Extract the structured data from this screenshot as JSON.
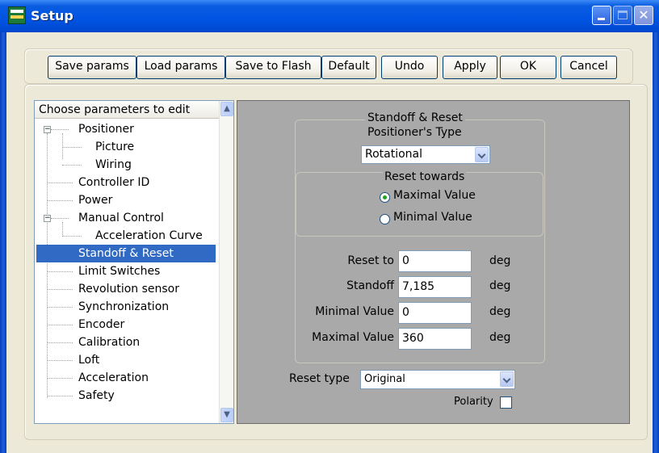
{
  "window": {
    "title": "Setup"
  },
  "toolbar": {
    "buttons": [
      "Save params",
      "Load params",
      "Save to Flash",
      "Default",
      "Undo",
      "Apply",
      "OK",
      "Cancel"
    ]
  },
  "tree": {
    "header": "Choose parameters to edit",
    "items": [
      "Positioner",
      "Picture",
      "Wiring",
      "Controller ID",
      "Power",
      "Manual Control",
      "Acceleration Curve",
      "Standoff & Reset",
      "Limit Switches",
      "Revolution sensor",
      "Synchronization",
      "Encoder",
      "Calibration",
      "Loft",
      "Acceleration",
      "Safety"
    ],
    "selected": "Standoff & Reset"
  },
  "panel": {
    "group_title": "Standoff & Reset",
    "positioner_type_label": "Positioner's Type",
    "positioner_type_value": "Rotational",
    "reset_towards_label": "Reset towards",
    "radio_options": [
      "Maximal Value",
      "Minimal Value"
    ],
    "radio_selected": "Maximal Value",
    "fields": [
      {
        "label": "Reset to",
        "value": "0",
        "unit": "deg"
      },
      {
        "label": "Standoff",
        "value": "7,185",
        "unit": "deg"
      },
      {
        "label": "Minimal Value",
        "value": "0",
        "unit": "deg"
      },
      {
        "label": "Maximal Value",
        "value": "360",
        "unit": "deg"
      }
    ],
    "reset_type_label": "Reset type",
    "reset_type_value": "Original",
    "polarity_label": "Polarity",
    "polarity_checked": false
  }
}
